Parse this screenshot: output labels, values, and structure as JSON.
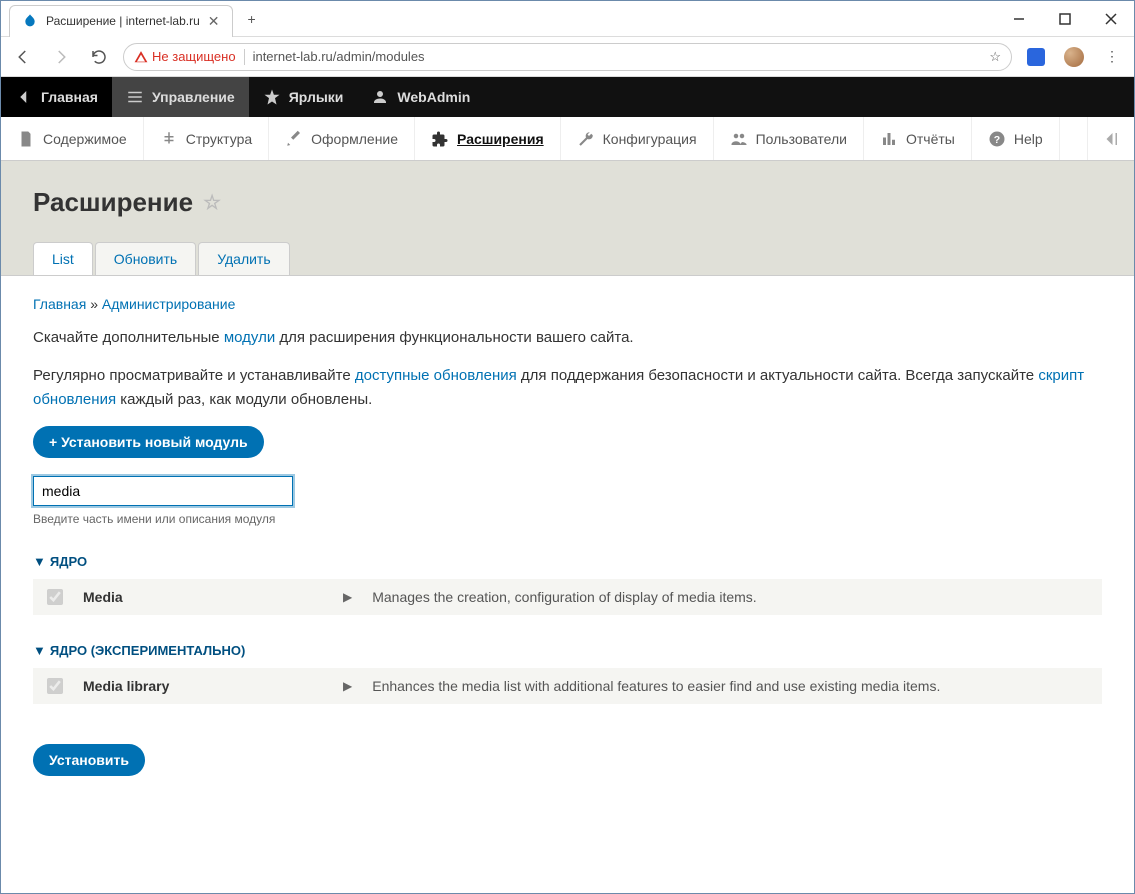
{
  "window": {
    "tab_title": "Расширение | internet-lab.ru",
    "not_secure": "Не защищено",
    "url": "internet-lab.ru/admin/modules"
  },
  "toolbar": {
    "home": "Главная",
    "manage": "Управление",
    "shortcuts": "Ярлыки",
    "user": "WebAdmin"
  },
  "adminmenu": {
    "content": "Содержимое",
    "structure": "Структура",
    "appearance": "Оформление",
    "extend": "Расширения",
    "config": "Конфигурация",
    "people": "Пользователи",
    "reports": "Отчёты",
    "help": "Help"
  },
  "page": {
    "title": "Расширение",
    "tabs": {
      "list": "List",
      "update": "Обновить",
      "uninstall": "Удалить"
    },
    "breadcrumb": {
      "home": "Главная",
      "sep": "»",
      "admin": "Администрирование"
    },
    "p1_a": "Скачайте дополнительные ",
    "p1_link": "модули",
    "p1_b": " для расширения функциональности вашего сайта.",
    "p2_a": "Регулярно просматривайте и устанавливайте ",
    "p2_link1": "доступные обновления",
    "p2_b": " для поддержания безопасности и актуальности сайта. Всегда запускайте ",
    "p2_link2": "скрипт обновления",
    "p2_c": " каждый раз, как модули обновлены.",
    "install_new": "+ Установить новый модуль",
    "filter_value": "media",
    "filter_desc": "Введите часть имени или описания модуля",
    "section_core": "ЯДРО",
    "section_core_exp": "ЯДРО (ЭКСПЕРИМЕНТАЛЬНО)",
    "modules": {
      "media": {
        "name": "Media",
        "desc": "Manages the creation, configuration of display of media items."
      },
      "media_library": {
        "name": "Media library",
        "desc": "Enhances the media list with additional features to easier find and use existing media items."
      }
    },
    "install_btn": "Установить"
  }
}
